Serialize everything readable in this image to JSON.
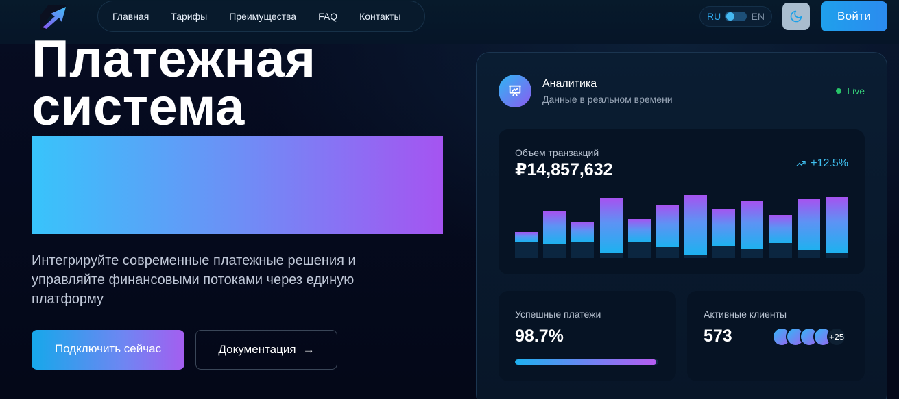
{
  "header": {
    "logo_icon": "arrow-up-right-logo-icon",
    "nav": [
      {
        "label": "Главная"
      },
      {
        "label": "Тарифы"
      },
      {
        "label": "Преимущества"
      },
      {
        "label": "FAQ"
      },
      {
        "label": "Контакты"
      }
    ],
    "lang": {
      "ru": "RU",
      "en": "EN",
      "active": "RU"
    },
    "theme_icon": "moon-icon",
    "login_label": "Войти"
  },
  "hero": {
    "title_line1": "Платежная",
    "title_line2": "система",
    "subtitle": "Интегрируйте современные платежные решения и управляйте финансовыми потоками через единую платформу",
    "primary_cta": "Подключить сейчас",
    "secondary_cta": "Документация",
    "secondary_cta_arrow": "→"
  },
  "analytics": {
    "icon": "presentation-chart-icon",
    "title": "Аналитика",
    "subtitle": "Данные в реальном времени",
    "live_label": "Live",
    "volume": {
      "label": "Объем транзакций",
      "value": "₽14,857,632",
      "growth": "+12.5%",
      "growth_icon": "trend-up-icon"
    },
    "chart_data": {
      "type": "bar",
      "values": [
        {
          "fill_top": 0.4,
          "fill_bottom": 0.25,
          "track": 0.4
        },
        {
          "fill_top": 0.72,
          "fill_bottom": 0.22,
          "track": 0.72
        },
        {
          "fill_top": 0.56,
          "fill_bottom": 0.25,
          "track": 0.56
        },
        {
          "fill_top": 0.93,
          "fill_bottom": 0.09,
          "track": 0.93
        },
        {
          "fill_top": 0.61,
          "fill_bottom": 0.25,
          "track": 0.61
        },
        {
          "fill_top": 0.82,
          "fill_bottom": 0.17,
          "track": 0.82
        },
        {
          "fill_top": 0.98,
          "fill_bottom": 0.05,
          "track": 0.98
        },
        {
          "fill_top": 0.77,
          "fill_bottom": 0.19,
          "track": 0.77
        },
        {
          "fill_top": 0.88,
          "fill_bottom": 0.14,
          "track": 0.88
        },
        {
          "fill_top": 0.67,
          "fill_bottom": 0.23,
          "track": 0.67
        },
        {
          "fill_top": 0.91,
          "fill_bottom": 0.12,
          "track": 0.91
        },
        {
          "fill_top": 0.95,
          "fill_bottom": 0.08,
          "track": 0.95
        }
      ]
    },
    "success": {
      "label": "Успешные платежи",
      "value": "98.7%",
      "progress": 0.987
    },
    "clients": {
      "label": "Активные клиенты",
      "value": "573",
      "avatar_count": 4,
      "more": "+25"
    }
  },
  "colors": {
    "accent_blue": "#1fa0ec",
    "accent_purple": "#a554f1",
    "live_green": "#27c468",
    "background": "#050a1c"
  }
}
